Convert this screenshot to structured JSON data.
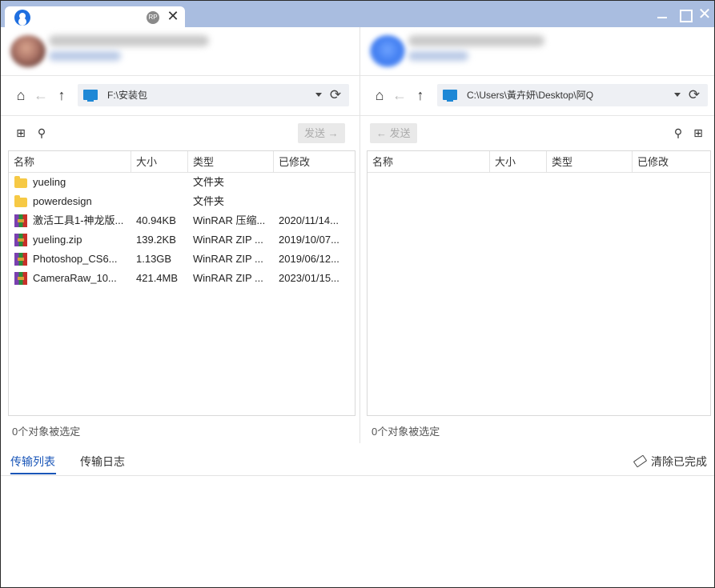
{
  "tab": {
    "badge": "RP",
    "close": "✕"
  },
  "window": {
    "close": "✕"
  },
  "left": {
    "path": "F:\\安装包",
    "send_label": "发送 →",
    "columns": [
      "名称",
      "大小",
      "类型",
      "已修改"
    ],
    "files": [
      {
        "name": "yueling",
        "size": "",
        "type": "文件夹",
        "modified": "",
        "icon": "folder-icon"
      },
      {
        "name": "powerdesign",
        "size": "",
        "type": "文件夹",
        "modified": "",
        "icon": "folder-icon"
      },
      {
        "name": "激活工具1-神龙版...",
        "size": "40.94KB",
        "type": "WinRAR 压缩...",
        "modified": "2020/11/14...",
        "icon": "rar-icon"
      },
      {
        "name": "yueling.zip",
        "size": "139.2KB",
        "type": "WinRAR ZIP ...",
        "modified": "2019/10/07...",
        "icon": "rar-icon"
      },
      {
        "name": "Photoshop_CS6...",
        "size": "1.13GB",
        "type": "WinRAR ZIP ...",
        "modified": "2019/06/12...",
        "icon": "rar-icon"
      },
      {
        "name": "CameraRaw_10...",
        "size": "421.4MB",
        "type": "WinRAR ZIP ...",
        "modified": "2023/01/15...",
        "icon": "rar-icon"
      }
    ],
    "status": "0个对象被选定"
  },
  "right": {
    "path": "C:\\Users\\黃卉妍\\Desktop\\阿Q",
    "send_label": "← 发送",
    "columns": [
      "名称",
      "大小",
      "类型",
      "已修改"
    ],
    "status": "0个对象被选定"
  },
  "transfer": {
    "tabs": [
      "传输列表",
      "传输日志"
    ],
    "clear_label": "清除已完成"
  },
  "icons": {
    "home": "⌂",
    "back": "←",
    "up": "↑",
    "refresh": "⟳",
    "search": "⚲",
    "new_folder": "⊞"
  },
  "colors": {
    "accent": "#1a56b8",
    "titlebar": "#a9bde0",
    "monitor": "#1e88d6"
  }
}
